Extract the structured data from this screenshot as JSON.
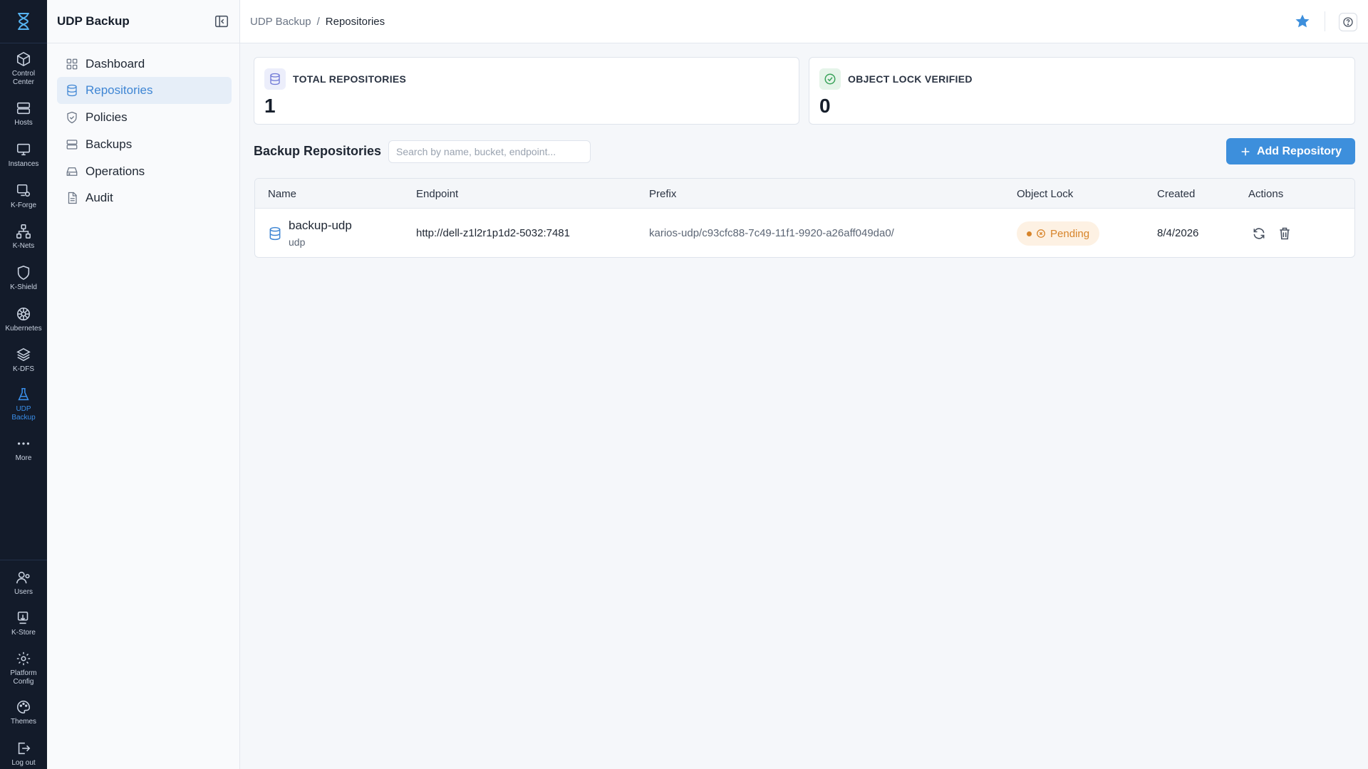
{
  "rail": {
    "items": [
      {
        "label": "Control Center",
        "icon": "cube-icon"
      },
      {
        "label": "Hosts",
        "icon": "server-icon"
      },
      {
        "label": "Instances",
        "icon": "monitor-icon"
      },
      {
        "label": "K-Forge",
        "icon": "forge-icon"
      },
      {
        "label": "K-Nets",
        "icon": "network-icon"
      },
      {
        "label": "K-Shield",
        "icon": "shield-icon"
      },
      {
        "label": "Kubernetes",
        "icon": "helm-icon"
      },
      {
        "label": "K-DFS",
        "icon": "layers-icon"
      },
      {
        "label": "UDP Backup",
        "icon": "flask-icon"
      },
      {
        "label": "More",
        "icon": "more-icon"
      }
    ],
    "bottom": [
      {
        "label": "Users",
        "icon": "users-icon"
      },
      {
        "label": "K-Store",
        "icon": "store-icon"
      },
      {
        "label": "Platform Config",
        "icon": "gear-icon"
      },
      {
        "label": "Themes",
        "icon": "palette-icon"
      },
      {
        "label": "Log out",
        "icon": "logout-icon"
      }
    ]
  },
  "sidebar": {
    "title": "UDP Backup",
    "items": [
      {
        "label": "Dashboard"
      },
      {
        "label": "Repositories"
      },
      {
        "label": "Policies"
      },
      {
        "label": "Backups"
      },
      {
        "label": "Operations"
      },
      {
        "label": "Audit"
      }
    ]
  },
  "breadcrumb": {
    "parent": "UDP Backup",
    "separator": "/",
    "current": "Repositories"
  },
  "stats": {
    "total_label": "TOTAL REPOSITORIES",
    "total_value": "1",
    "lock_label": "OBJECT LOCK VERIFIED",
    "lock_value": "0"
  },
  "section": {
    "title": "Backup Repositories",
    "search_placeholder": "Search by name, bucket, endpoint...",
    "add_label": "Add Repository"
  },
  "table": {
    "headers": [
      "Name",
      "Endpoint",
      "Prefix",
      "Object Lock",
      "Created",
      "Actions"
    ],
    "rows": [
      {
        "name": "backup-udp",
        "bucket": "udp",
        "endpoint": "http://dell-z1l2r1p1d2-5032:7481",
        "prefix": "karios-udp/c93cfc88-7c49-11f1-9920-a26aff049da0/",
        "lock": "Pending",
        "created": "8/4/2026"
      }
    ]
  },
  "colors": {
    "accent": "#3d8fdc",
    "rail_bg": "#131b2a",
    "pending": "#d7842a"
  }
}
